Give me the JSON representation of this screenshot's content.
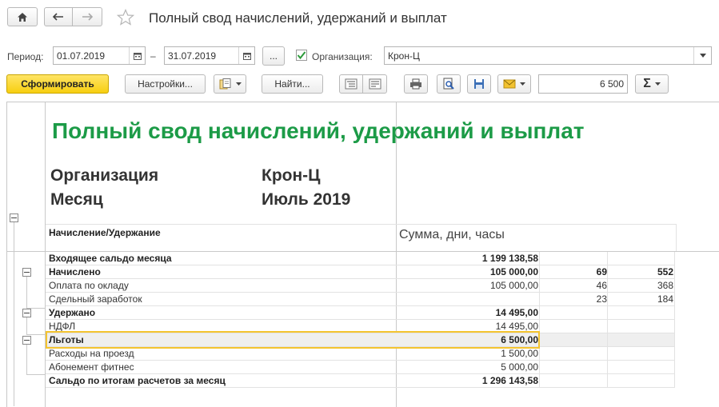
{
  "window": {
    "title": "Полный свод начислений, удержаний и выплат"
  },
  "filters": {
    "period_label": "Период:",
    "date_from": "01.07.2019",
    "date_to": "31.07.2019",
    "dash": "–",
    "more_label": "...",
    "org_label": "Организация:",
    "org_value": "Крон-Ц",
    "org_checked": true
  },
  "toolbar": {
    "generate_label": "Сформировать",
    "settings_label": "Настройки...",
    "find_label": "Найти...",
    "sum_field": "6 500",
    "sum_symbol": "Σ"
  },
  "report": {
    "title": "Полный свод начислений, удержаний и выплат",
    "org_caption": "Организация",
    "org_value": "Крон-Ц",
    "month_caption": "Месяц",
    "month_value": "Июль 2019",
    "col_name": "Начисление/Удержание",
    "col_sum": "Сумма, дни, часы",
    "rows": [
      {
        "name": "Входящее сальдо месяца",
        "sum": "1 199 138,58",
        "days": "",
        "hours": "",
        "bold": true
      },
      {
        "name": "Начислено",
        "sum": "105 000,00",
        "days": "69",
        "hours": "552",
        "bold": true
      },
      {
        "name": "Оплата по окладу",
        "sum": "105 000,00",
        "days": "46",
        "hours": "368",
        "bold": false
      },
      {
        "name": "Сдельный заработок",
        "sum": "",
        "days": "23",
        "hours": "184",
        "bold": false
      },
      {
        "name": "Удержано",
        "sum": "14 495,00",
        "days": "",
        "hours": "",
        "bold": true
      },
      {
        "name": "НДФЛ",
        "sum": "14 495,00",
        "days": "",
        "hours": "",
        "bold": false
      },
      {
        "name": "Льготы",
        "sum": "6 500,00",
        "days": "",
        "hours": "",
        "bold": true,
        "selected": true
      },
      {
        "name": "Расходы на проезд",
        "sum": "1 500,00",
        "days": "",
        "hours": "",
        "bold": false
      },
      {
        "name": "Абонемент фитнес",
        "sum": "5 000,00",
        "days": "",
        "hours": "",
        "bold": false
      },
      {
        "name": "Сальдо по итогам расчетов за месяц",
        "sum": "1 296 143,58",
        "days": "",
        "hours": "",
        "bold": true
      }
    ]
  },
  "colors": {
    "title_green": "#1c9b47",
    "primary_yellow": "#f7cf10",
    "highlight_frame": "#f4c430",
    "check_green": "#2e9b3c"
  }
}
